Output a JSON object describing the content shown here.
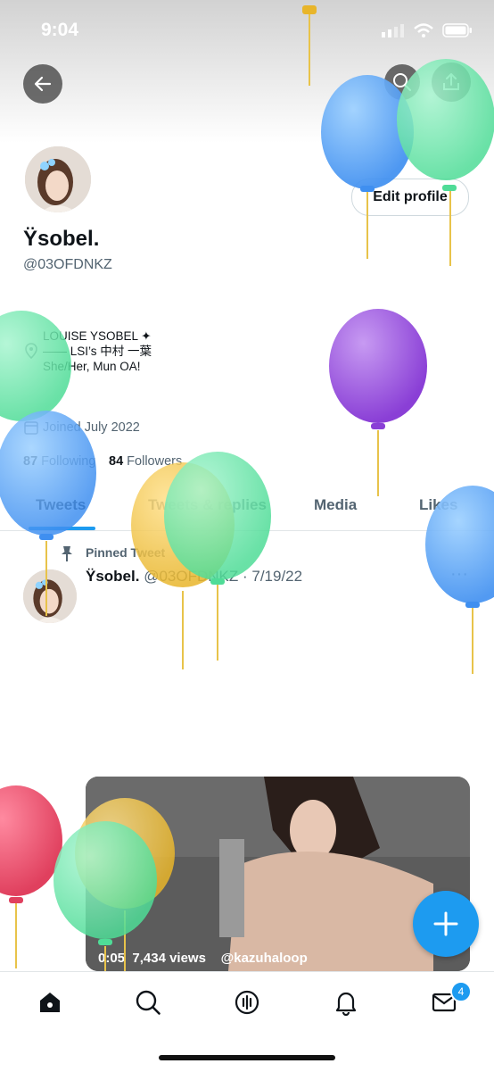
{
  "status": {
    "time": "9:04"
  },
  "profile": {
    "name": "Ÿsobel.",
    "handle": "@03OFDNKZ",
    "edit_label": "Edit profile",
    "bio": {
      "line1": "LOUISE YSOBEL ✦",
      "line2": "—— LSI’s 中村 一葉",
      "line3": "She/Her,  Mun OA!"
    },
    "joined": "Joined July 2022",
    "following_count": "87",
    "following_label": "Following",
    "followers_count": "84",
    "followers_label": "Followers"
  },
  "tabs": [
    {
      "label": "Tweets"
    },
    {
      "label": "Tweets & replies"
    },
    {
      "label": "Media"
    },
    {
      "label": "Likes"
    }
  ],
  "pinned_tweet": {
    "pinned_label": "Pinned Tweet",
    "author": "Ÿsobel.",
    "handle_date": "@03OFDNKZ · 7/19/22",
    "video": {
      "duration": "0:05",
      "views": "7,434 views",
      "credit": "@kazuhaloop"
    }
  },
  "nav": {
    "messages_badge": "4"
  },
  "colors": {
    "accent": "#1d9bf0"
  }
}
